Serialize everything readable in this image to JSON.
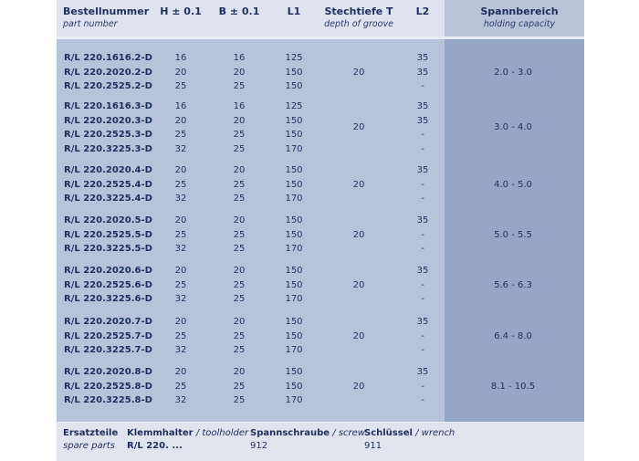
{
  "header": {
    "order_no": "Bestellnummer",
    "order_no_en": "part number",
    "h": "H ± 0.1",
    "b": "B ± 0.1",
    "l1": "L1",
    "depth": "Stechtiefe T",
    "depth_en": "depth of groove",
    "l2": "L2",
    "range": "Spannbereich",
    "range_en": "holding capacity"
  },
  "groups": [
    {
      "depth": "20",
      "range": "2.0 - 3.0",
      "rows": [
        {
          "code": "R/L 220.1616.2-D",
          "h": "16",
          "b": "16",
          "l1": "125",
          "l2": "35"
        },
        {
          "code": "R/L 220.2020.2-D",
          "h": "20",
          "b": "20",
          "l1": "150",
          "l2": "35"
        },
        {
          "code": "R/L 220.2525.2-D",
          "h": "25",
          "b": "25",
          "l1": "150",
          "l2": "-"
        }
      ]
    },
    {
      "depth": "20",
      "range": "3.0 - 4.0",
      "rows": [
        {
          "code": "R/L 220.1616.3-D",
          "h": "16",
          "b": "16",
          "l1": "125",
          "l2": "35"
        },
        {
          "code": "R/L 220.2020.3-D",
          "h": "20",
          "b": "20",
          "l1": "150",
          "l2": "35"
        },
        {
          "code": "R/L 220.2525.3-D",
          "h": "25",
          "b": "25",
          "l1": "150",
          "l2": "-"
        },
        {
          "code": "R/L 220.3225.3-D",
          "h": "32",
          "b": "25",
          "l1": "170",
          "l2": "-"
        }
      ]
    },
    {
      "depth": "20",
      "range": "4.0 - 5.0",
      "rows": [
        {
          "code": "R/L 220.2020.4-D",
          "h": "20",
          "b": "20",
          "l1": "150",
          "l2": "35"
        },
        {
          "code": "R/L 220.2525.4-D",
          "h": "25",
          "b": "25",
          "l1": "150",
          "l2": "-"
        },
        {
          "code": "R/L 220.3225.4-D",
          "h": "32",
          "b": "25",
          "l1": "170",
          "l2": "-"
        }
      ]
    },
    {
      "depth": "20",
      "range": "5.0 - 5.5",
      "rows": [
        {
          "code": "R/L 220.2020.5-D",
          "h": "20",
          "b": "20",
          "l1": "150",
          "l2": "35"
        },
        {
          "code": "R/L 220.2525.5-D",
          "h": "25",
          "b": "25",
          "l1": "150",
          "l2": "-"
        },
        {
          "code": "R/L 220.3225.5-D",
          "h": "32",
          "b": "25",
          "l1": "170",
          "l2": "-"
        }
      ]
    },
    {
      "depth": "20",
      "range": "5.6 - 6.3",
      "rows": [
        {
          "code": "R/L 220.2020.6-D",
          "h": "20",
          "b": "20",
          "l1": "150",
          "l2": "35"
        },
        {
          "code": "R/L 220.2525.6-D",
          "h": "25",
          "b": "25",
          "l1": "150",
          "l2": "-"
        },
        {
          "code": "R/L 220.3225.6-D",
          "h": "32",
          "b": "25",
          "l1": "170",
          "l2": "-"
        }
      ]
    },
    {
      "depth": "20",
      "range": "6.4 - 8.0",
      "rows": [
        {
          "code": "R/L 220.2020.7-D",
          "h": "20",
          "b": "20",
          "l1": "150",
          "l2": "35"
        },
        {
          "code": "R/L 220.2525.7-D",
          "h": "25",
          "b": "25",
          "l1": "150",
          "l2": "-"
        },
        {
          "code": "R/L 220.3225.7-D",
          "h": "32",
          "b": "25",
          "l1": "170",
          "l2": "-"
        }
      ]
    },
    {
      "depth": "20",
      "range": "8.1 - 10.5",
      "rows": [
        {
          "code": "R/L 220.2020.8-D",
          "h": "20",
          "b": "20",
          "l1": "150",
          "l2": "35"
        },
        {
          "code": "R/L 220.2525.8-D",
          "h": "25",
          "b": "25",
          "l1": "150",
          "l2": "-"
        },
        {
          "code": "R/L 220.3225.8-D",
          "h": "32",
          "b": "25",
          "l1": "170",
          "l2": "-"
        }
      ]
    }
  ],
  "footer": {
    "spare": "Ersatzteile",
    "spare_en": "spare parts",
    "holder": "Klemmhalter",
    "holder_en": "/ toolholder",
    "holder_val": "R/L 220. ...",
    "screw": "Spannschraube",
    "screw_en": "/ screw",
    "screw_val": "912",
    "wrench": "Schlüssel",
    "wrench_en": "/ wrench",
    "wrench_val": "911"
  }
}
